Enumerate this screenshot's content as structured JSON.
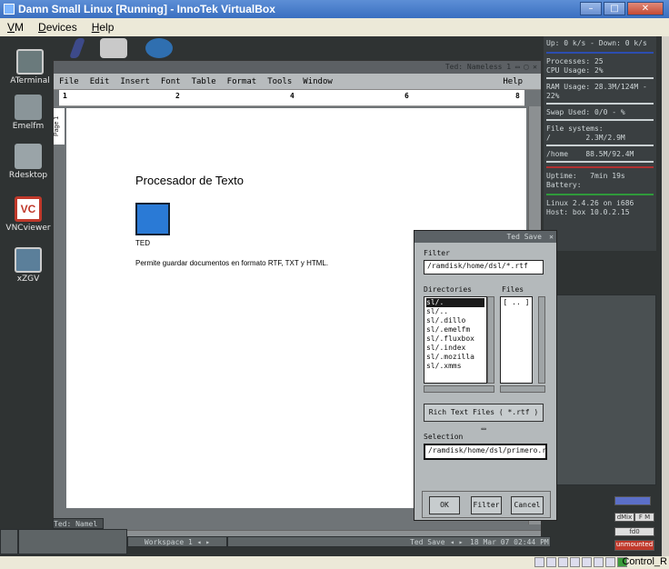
{
  "host": {
    "title": "Damn Small Linux [Running] - InnoTek VirtualBox",
    "menu": [
      {
        "key": "V",
        "rest": "M"
      },
      {
        "key": "D",
        "rest": "evices"
      },
      {
        "key": "H",
        "rest": "elp"
      }
    ],
    "host_key": "Control_R"
  },
  "desktop": {
    "icons": [
      {
        "label": "ATerminal",
        "color": "#6a7a7c"
      },
      {
        "label": "Emelfm",
        "color": "#8a9599"
      },
      {
        "label": "Rdesktop",
        "color": "#9aa4a8"
      },
      {
        "label": "VNCviewer",
        "color": "#c0392b"
      },
      {
        "label": "xZGV",
        "color": "#5b7f9a"
      }
    ]
  },
  "ted": {
    "title": "Ted: Nameless 1",
    "menu": [
      "File",
      "Edit",
      "Insert",
      "Font",
      "Table",
      "Format",
      "Tools",
      "Window"
    ],
    "help": "Help",
    "ruler_marks": [
      "1",
      "2",
      "4",
      "6",
      "8"
    ],
    "page_label": "Page 1",
    "doc": {
      "heading": "Procesador de Texto",
      "app_name": "TED",
      "body": "Permite guardar documentos en formato RTF, TXT y HTML."
    }
  },
  "sysmon": {
    "net": "Up: 0 k/s - Down: 0 k/s",
    "processes": "Processes: 25",
    "cpu": "CPU Usage: 2%",
    "ram": "RAM Usage: 28.3M/124M - 22%",
    "swap": "Swap Used: 0/0 - %",
    "fs_label": "File systems:",
    "fs_root": "/        2.3M/2.9M",
    "fs_home": "/home    88.5M/92.4M",
    "uptime": "Uptime:   7min 19s",
    "battery": "Battery:",
    "kernel": "Linux 2.4.26 on i686",
    "host": "Host: box 10.0.2.15"
  },
  "save_dialog": {
    "title": "Ted Save",
    "filter_label": "Filter",
    "filter_value": "/ramdisk/home/dsl/*.rtf",
    "directories_label": "Directories",
    "files_label": "Files",
    "directories": [
      "sl/.",
      "sl/..",
      "sl/.dillo",
      "sl/.emelfm",
      "sl/.fluxbox",
      "sl/.index",
      "sl/.mozilla",
      "sl/.xmms"
    ],
    "files": [
      "[ .. ]"
    ],
    "filetype": "Rich Text Files ( *.rtf )",
    "selection_label": "Selection",
    "selection_value": "/ramdisk/home/dsl/primero.rtf",
    "ok": "OK",
    "filter_btn": "Filter",
    "cancel": "Cancel"
  },
  "taskbar": {
    "ted_name": "Ted: Namel",
    "workspace": "Workspace 1",
    "task": "Ted Save",
    "clock": "18 Mar 07 02:44 PM"
  },
  "widgets": {
    "dmix": "dMix",
    "fm": "F M",
    "fd0": "fd0",
    "unmounted": "unmounted"
  }
}
